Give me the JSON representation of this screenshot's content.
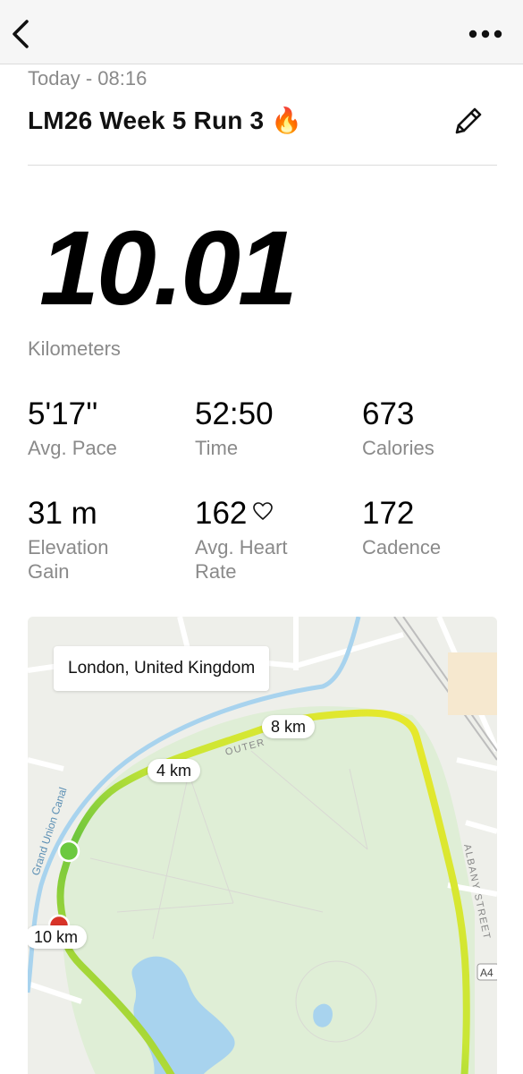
{
  "nav": {
    "back_icon": "chevron-left-icon",
    "more_icon": "more-horizontal-icon"
  },
  "activity": {
    "datetime": "Today - 08:16",
    "title": "LM26 Week 5 Run 3 🔥",
    "edit_icon": "pencil-icon"
  },
  "distance": {
    "value": "10.01",
    "unit": "Kilometers"
  },
  "stats": [
    {
      "value": "5'17''",
      "label": "Avg. Pace"
    },
    {
      "value": "52:50",
      "label": "Time"
    },
    {
      "value": "673",
      "label": "Calories"
    },
    {
      "value": "31 m",
      "label": "Elevation Gain"
    },
    {
      "value": "162",
      "label": "Avg. Heart Rate",
      "icon": "heart-outline-icon"
    },
    {
      "value": "172",
      "label": "Cadence"
    }
  ],
  "map": {
    "location": "London, United Kingdom",
    "markers": [
      "4 km",
      "8 km",
      "10 km"
    ],
    "street_labels": [
      "Grand Union Canal",
      "OUTER",
      "ALBANY STREET",
      "A4"
    ],
    "colors": {
      "start": "#6cc93f",
      "end": "#d83328",
      "route_fast": "#6fc63d",
      "route_slow": "#e6e82a",
      "water": "#a8d3ee",
      "park": "#dfeed6"
    }
  }
}
